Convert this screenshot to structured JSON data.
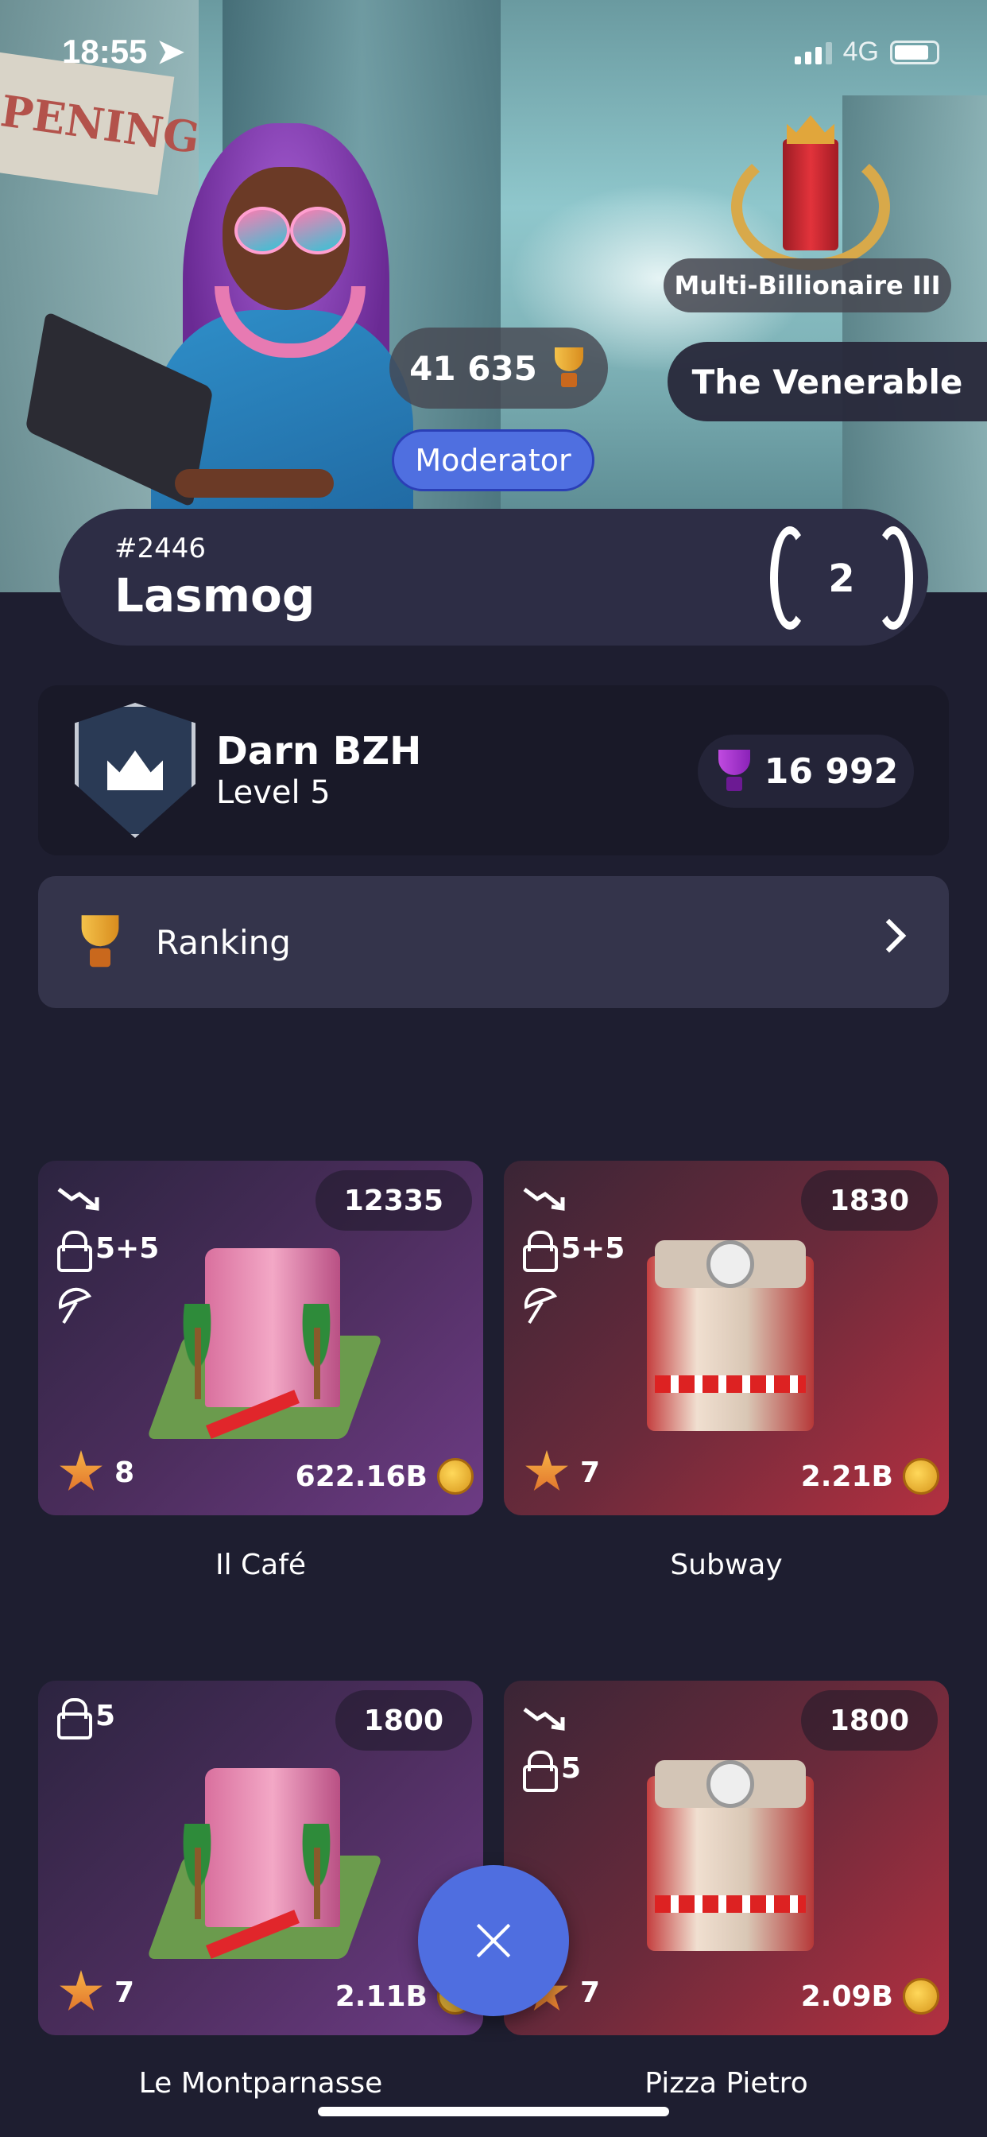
{
  "status_bar": {
    "time": "18:55",
    "network": "4G"
  },
  "profile": {
    "title_badge": "Multi-Billionaire III",
    "title_name": "The Venerable",
    "score": "41 635",
    "role": "Moderator",
    "player_id": "#2446",
    "player_name": "Lasmog",
    "rank_level": "2"
  },
  "clan": {
    "name": "Darn BZH",
    "level": "Level 5",
    "score": "16 992"
  },
  "ranking": {
    "label": "Ranking"
  },
  "businesses": [
    {
      "name": "Il Café",
      "count": "12335",
      "lock": "5+5",
      "stars": "8",
      "money": "622.16B",
      "trend": true,
      "umbrella": true
    },
    {
      "name": "Subway",
      "count": "1830",
      "lock": "5+5",
      "stars": "7",
      "money": "2.21B",
      "trend": true,
      "umbrella": true
    },
    {
      "name": "Le Montparnasse",
      "count": "1800",
      "lock": "5",
      "stars": "7",
      "money": "2.11B",
      "trend": false,
      "umbrella": false
    },
    {
      "name": "Pizza Pietro",
      "count": "1800",
      "lock": "5",
      "stars": "7",
      "money": "2.09B",
      "trend": true,
      "umbrella": false
    }
  ],
  "icons": [
    "trending-down-icon",
    "lock-icon",
    "umbrella-icon",
    "star-icon",
    "coin-icon",
    "trophy-icon",
    "close-icon",
    "chevron-right-icon"
  ]
}
